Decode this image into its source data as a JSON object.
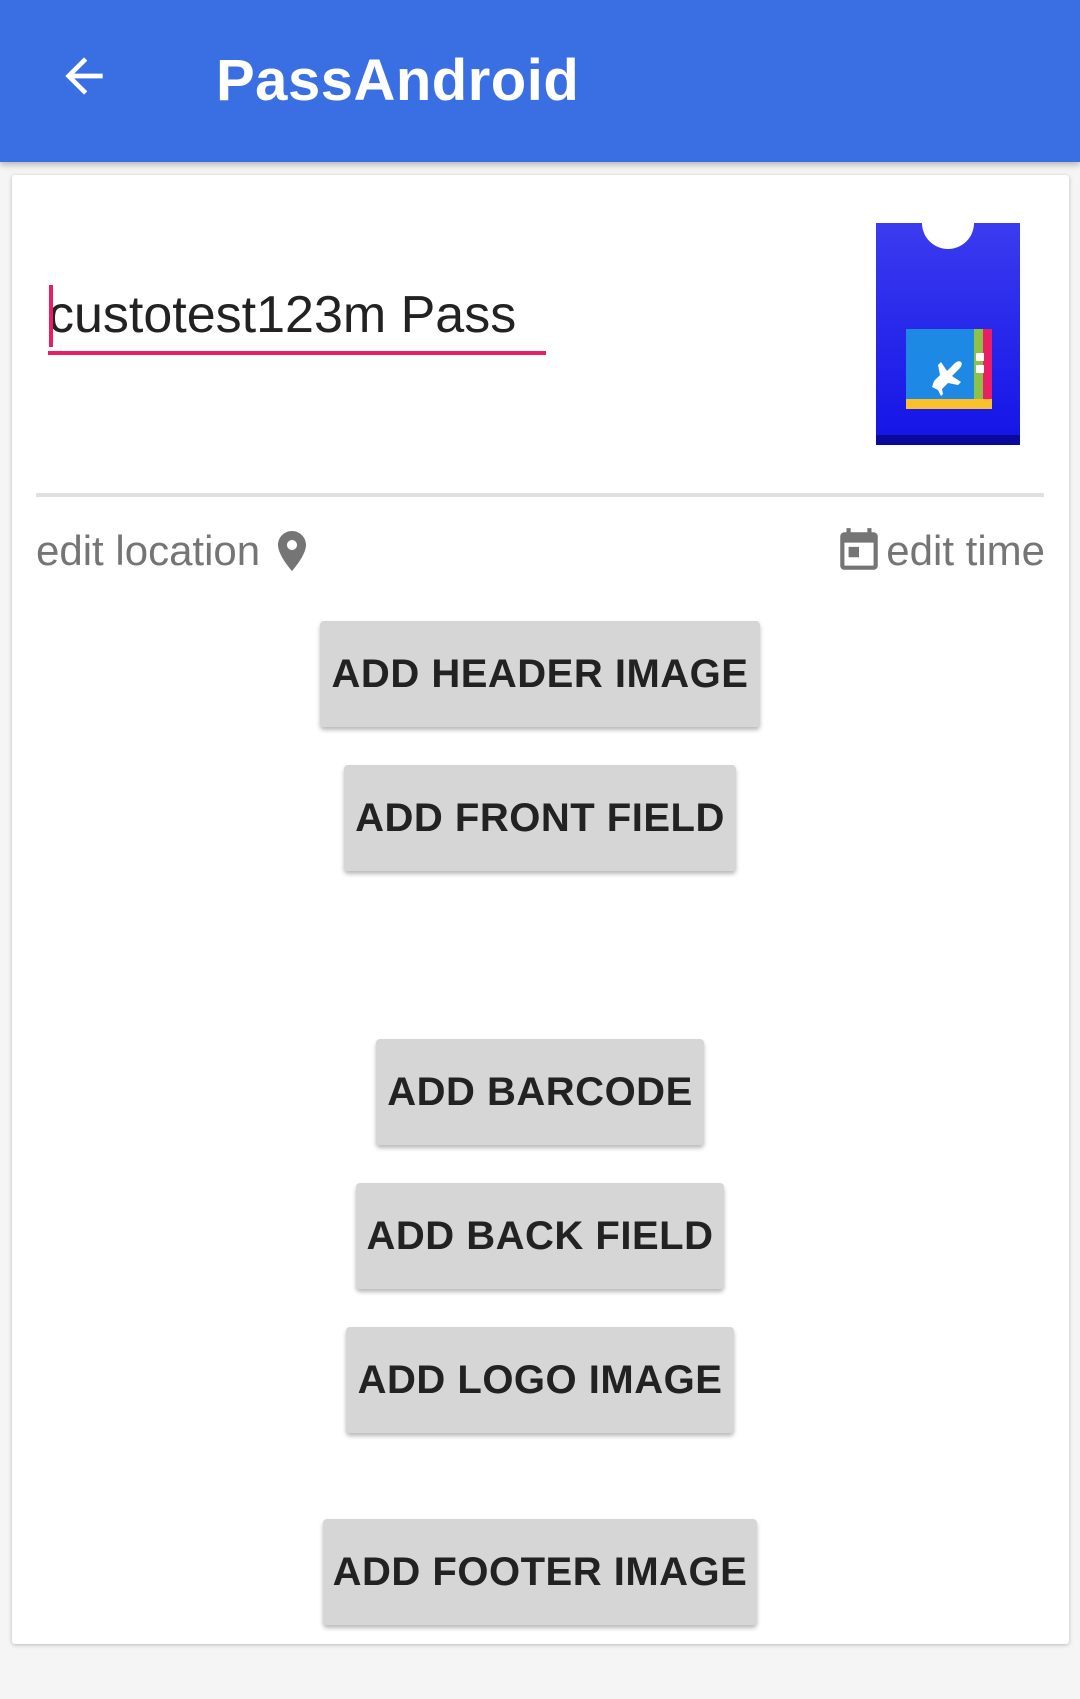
{
  "appbar": {
    "title": "PassAndroid",
    "back_icon": "arrow-back-icon",
    "color": "#3a6fe4"
  },
  "pass": {
    "name_value": "custotest123m Pass",
    "icon": "boarding-pass-icon"
  },
  "meta": {
    "location_label": "edit location",
    "location_icon": "map-pin-icon",
    "time_label": "edit time",
    "time_icon": "calendar-icon"
  },
  "buttons": {
    "add_header_image": "ADD HEADER IMAGE",
    "add_front_field": "ADD FRONT FIELD",
    "add_barcode": "ADD BARCODE",
    "add_back_field": "ADD BACK FIELD",
    "add_logo_image": "ADD LOGO IMAGE",
    "add_footer_image": "ADD FOOTER IMAGE"
  },
  "colors": {
    "accent": "#e91e63",
    "button_bg": "#d6d6d6"
  }
}
